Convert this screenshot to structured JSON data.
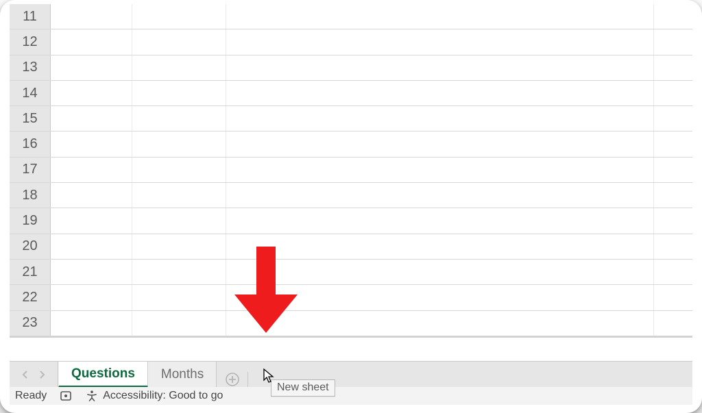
{
  "rows": [
    "11",
    "12",
    "13",
    "14",
    "15",
    "16",
    "17",
    "18",
    "19",
    "20",
    "21",
    "22",
    "23"
  ],
  "tabs": {
    "prev_aria": "Previous sheet",
    "next_aria": "Next sheet",
    "active": "Questions",
    "items": [
      {
        "label": "Questions",
        "active": true
      },
      {
        "label": "Months",
        "active": false
      }
    ],
    "new_sheet_aria": "New sheet"
  },
  "status": {
    "ready": "Ready",
    "accessibility": "Accessibility: Good to go"
  },
  "tooltip": "New sheet",
  "annotation": {
    "color": "#ee1c1c",
    "kind": "arrow-down"
  }
}
